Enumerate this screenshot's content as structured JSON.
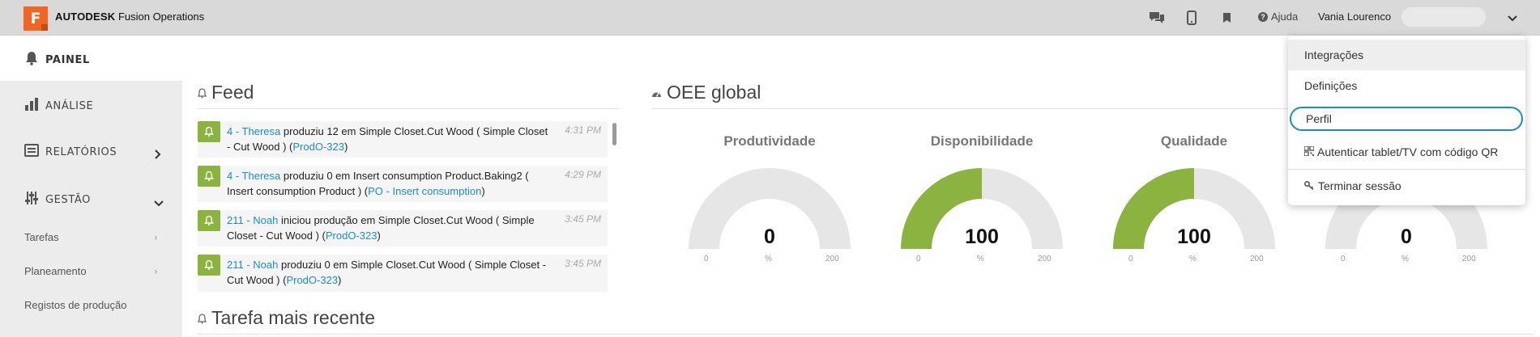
{
  "topbar": {
    "logo_letter": "F",
    "brand_bold": "AUTODESK",
    "brand_rest": "Fusion Operations",
    "icons": [
      "chat-icon",
      "tablet-icon",
      "bookmark-icon"
    ],
    "help_label": "Ajuda",
    "user_name": "Vania Lourenco"
  },
  "sidebar": {
    "painel": "PAINEL",
    "analise": "ANÁLISE",
    "relatorios": "RELATÓRIOS",
    "gestao": "GESTÃO",
    "sub_items": [
      "Tarefas",
      "Planeamento",
      "Registos de produção"
    ]
  },
  "feed": {
    "title": "Feed",
    "items": [
      {
        "user": "4 - Theresa",
        "text": " produziu 12 em Simple Closet.Cut Wood ( Simple Closet - Cut Wood ) (",
        "link": "ProdO-323",
        "end": ")",
        "time": "4:31 PM"
      },
      {
        "user": "4 - Theresa",
        "text": " produziu 0 em Insert consumption Product.Baking2 ( Insert consumption Product ) (",
        "link": "PO - Insert consumption",
        "end": ")",
        "time": "4:29 PM"
      },
      {
        "user": "211 - Noah",
        "text": " iniciou produção em Simple Closet.Cut Wood ( Simple Closet - Cut Wood ) (",
        "link": "ProdO-323",
        "end": ")",
        "time": "3:45 PM"
      },
      {
        "user": "211 - Noah",
        "text": " produziu 0 em Simple Closet.Cut Wood ( Simple Closet - Cut Wood ) (",
        "link": "ProdO-323",
        "end": ")",
        "time": "3:45 PM"
      }
    ]
  },
  "recent_task": {
    "title": "Tarefa mais recente"
  },
  "oee": {
    "title": "OEE global",
    "gauges": [
      {
        "label": "Produtividade",
        "value": "0",
        "fraction": 0.0,
        "min": "0",
        "max": "200",
        "unit": "%"
      },
      {
        "label": "Disponibilidade",
        "value": "100",
        "fraction": 0.5,
        "min": "0",
        "max": "200",
        "unit": "%"
      },
      {
        "label": "Qualidade",
        "value": "100",
        "fraction": 0.5,
        "min": "0",
        "max": "200",
        "unit": "%"
      },
      {
        "label": "",
        "value": "0",
        "fraction": 0.0,
        "min": "0",
        "max": "200",
        "unit": "%"
      }
    ],
    "gauge_fill_color": "#8ab33f",
    "gauge_track_color": "#e6e6e6"
  },
  "user_menu": {
    "items": [
      "Integrações",
      "Definições",
      "Perfil",
      "Autenticar tablet/TV com código QR",
      "Terminar sessão"
    ]
  },
  "colors": {
    "accent": "#1a8dc7",
    "brand": "#f26522",
    "success": "#8ab33f"
  }
}
